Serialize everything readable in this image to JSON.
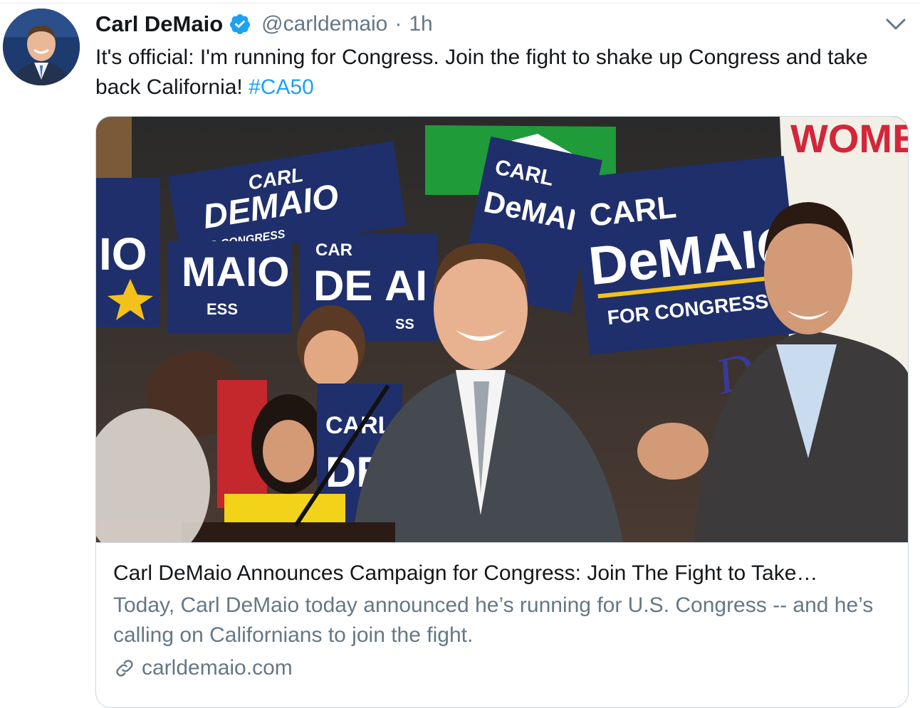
{
  "tweet": {
    "author_name": "Carl DeMaio",
    "handle": "@carldemaio",
    "separator": "·",
    "time": "1h",
    "text": "It's official: I'm running for Congress. Join the fight to shake up Congress and take back California!",
    "hashtag": "#CA50",
    "verified": true
  },
  "card": {
    "title": "Carl DeMaio Announces Campaign for Congress: Join The Fight to Take…",
    "description": "Today, Carl DeMaio today announced he’s running for U.S. Congress -- and he’s calling on Californians to join the fight.",
    "domain": "carldemaio.com",
    "photo_signs": {
      "sign_main_line1": "CARL",
      "sign_main_line2": "DeMAIO",
      "sign_main_line3": "FOR CONGRESS",
      "sign_left_line1": "CARL",
      "sign_left_line2": "DEMAIO",
      "sign_left_line3": "FOR CONGRESS",
      "sign_mid_line1": "CARL",
      "sign_mid_line2": "DeMAIO",
      "sign_small_1": "IO",
      "sign_small_2": "MAIO",
      "sign_small_3": "ESS",
      "sign_small_4": "CAR",
      "sign_small_5": "DE",
      "sign_small_6": "AI",
      "sign_small_7": "SS",
      "sign_bottom_line1": "CARL",
      "sign_bottom_line2": "DE",
      "sign_right_top": "WOMEN",
      "sign_right_side": "Dem"
    }
  },
  "icons": [
    "verified-badge-icon",
    "chevron-down-icon",
    "link-icon"
  ],
  "colors": {
    "verified": "#1da1f2",
    "hashtag": "#1da1f2",
    "secondary_text": "#657786",
    "border": "#ccd6dd",
    "sign_blue": "#1f2f6b",
    "sign_yellow": "#f3c21a"
  }
}
